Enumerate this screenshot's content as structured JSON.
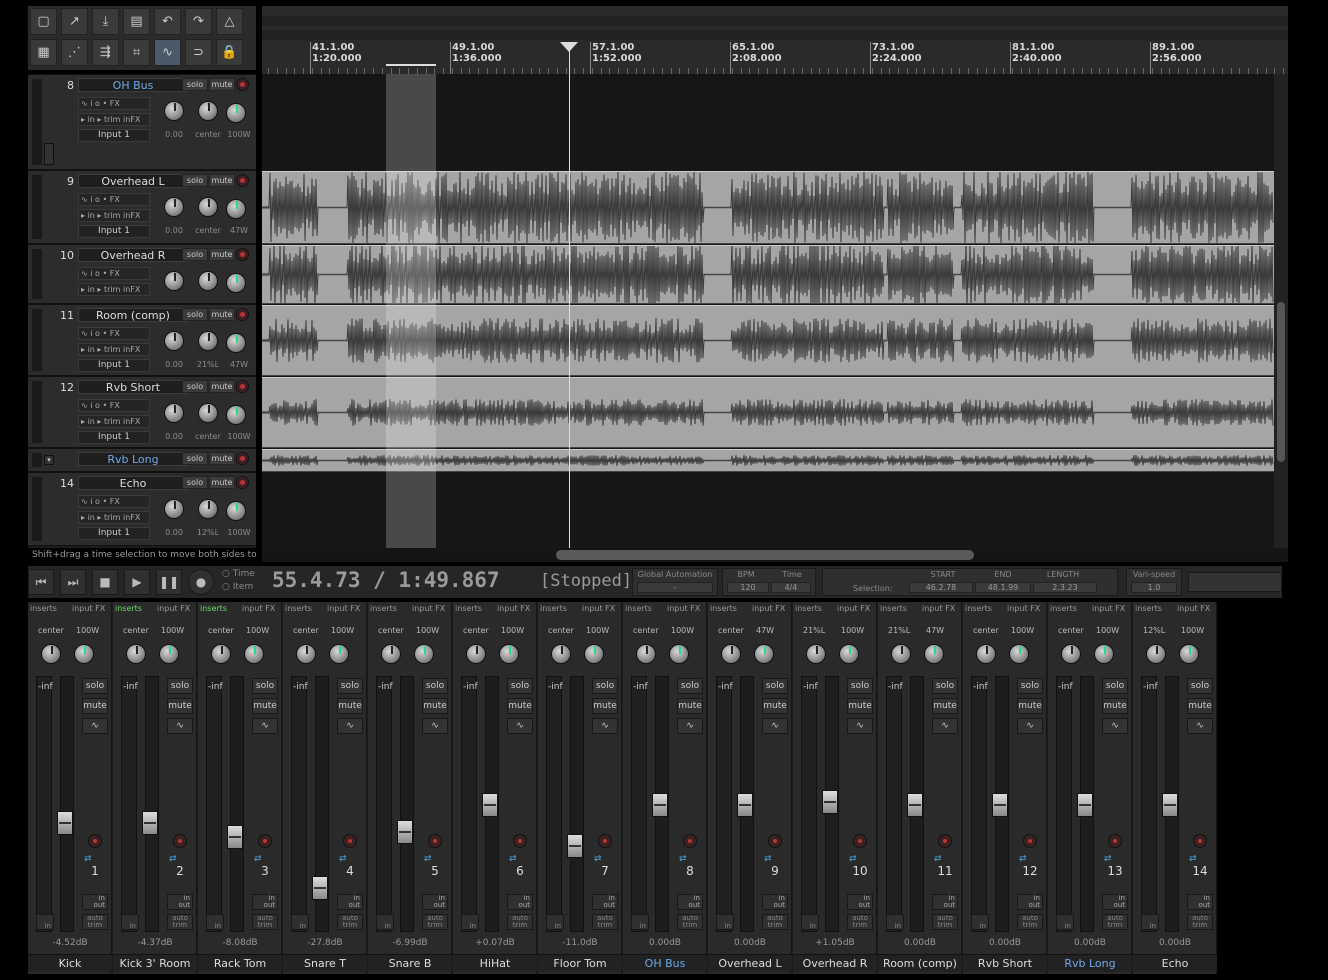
{
  "toolbar": {
    "icons": [
      "new-project-icon",
      "open-project-icon",
      "save-project-icon",
      "project-settings-icon",
      "undo-icon",
      "redo-icon",
      "metronome-icon",
      "grid-icon",
      "snap-icon",
      "ripple-edit-icon",
      "item-grouping-icon",
      "envelope-icon",
      "loop-icon",
      "lock-icon"
    ]
  },
  "tracks": [
    {
      "num": "8",
      "name": "OH Bus",
      "blue": true,
      "vol": "0.00",
      "pan": "center",
      "width": "100W",
      "input": "Input 1"
    },
    {
      "num": "9",
      "name": "Overhead L",
      "blue": false,
      "vol": "0.00",
      "pan": "center",
      "width": "47W",
      "input": "Input 1"
    },
    {
      "num": "10",
      "name": "Overhead R",
      "blue": false,
      "vol": "",
      "pan": "",
      "width": "",
      "input": ""
    },
    {
      "num": "11",
      "name": "Room (comp)",
      "blue": false,
      "vol": "0.00",
      "pan": "21%L",
      "width": "47W",
      "input": "Input 1"
    },
    {
      "num": "12",
      "name": "Rvb Short",
      "blue": false,
      "vol": "0.00",
      "pan": "center",
      "width": "100W",
      "input": "Input 1"
    },
    {
      "num": "",
      "name": "Rvb Long",
      "blue": true,
      "vol": "",
      "pan": "",
      "width": "",
      "input": ""
    },
    {
      "num": "14",
      "name": "Echo",
      "blue": false,
      "vol": "0.00",
      "pan": "12%L",
      "width": "100W",
      "input": "Input 1"
    }
  ],
  "tcp_labels": {
    "solo": "solo",
    "mute": "mute",
    "io": "i o",
    "fx": "FX",
    "in": "in",
    "trim": "trim",
    "infx": "inFX"
  },
  "ruler": [
    {
      "bar": "41.1.00",
      "time": "1:20.000"
    },
    {
      "bar": "49.1.00",
      "time": "1:36.000"
    },
    {
      "bar": "57.1.00",
      "time": "1:52.000"
    },
    {
      "bar": "65.1.00",
      "time": "2:08.000"
    },
    {
      "bar": "73.1.00",
      "time": "2:24.000"
    },
    {
      "bar": "81.1.00",
      "time": "2:40.000"
    },
    {
      "bar": "89.1.00",
      "time": "2:56.000"
    }
  ],
  "hint": "Shift+drag a time selection to move both sides togeth",
  "transport": {
    "time_label": "Time",
    "item_label": "Item",
    "position": "55.4.73 / 1:49.867",
    "status": "[Stopped]",
    "global_automation_label": "Global Automation",
    "global_automation_value": "-",
    "bpm_label": "BPM",
    "bpm": "120",
    "timesig_label": "Time",
    "timesig": "4/4",
    "selection_label": "Selection:",
    "start_label": "START",
    "start": "46.2.78",
    "end_label": "END",
    "end": "48.1.99",
    "length_label": "LENGTH",
    "length": "2.3.23",
    "varispeed_label": "Vari-speed",
    "varispeed": "1.0"
  },
  "mixer": {
    "labels": {
      "inserts": "inserts",
      "inputfx": "input FX",
      "inf": "-inf",
      "solo": "solo",
      "mute": "mute",
      "in": "in",
      "out": "out",
      "auto": "auto",
      "trim": "trim"
    },
    "channels": [
      {
        "num": "1",
        "name": "Kick",
        "pan": "center",
        "width": "100W",
        "vol": "-4.52dB",
        "fader": 0.42,
        "blue": false,
        "ins_on": false
      },
      {
        "num": "2",
        "name": "Kick 3' Room",
        "pan": "center",
        "width": "100W",
        "vol": "-4.37dB",
        "fader": 0.42,
        "blue": false,
        "ins_on": true
      },
      {
        "num": "3",
        "name": "Rack Tom",
        "pan": "center",
        "width": "100W",
        "vol": "-8.08dB",
        "fader": 0.36,
        "blue": false,
        "ins_on": true
      },
      {
        "num": "4",
        "name": "Snare T",
        "pan": "center",
        "width": "100W",
        "vol": "-27.8dB",
        "fader": 0.14,
        "blue": false,
        "ins_on": false
      },
      {
        "num": "5",
        "name": "Snare B",
        "pan": "center",
        "width": "100W",
        "vol": "-6.99dB",
        "fader": 0.38,
        "blue": false,
        "ins_on": false
      },
      {
        "num": "6",
        "name": "HiHat",
        "pan": "center",
        "width": "100W",
        "vol": "+0.07dB",
        "fader": 0.5,
        "blue": false,
        "ins_on": false
      },
      {
        "num": "7",
        "name": "Floor Tom",
        "pan": "center",
        "width": "100W",
        "vol": "-11.0dB",
        "fader": 0.32,
        "blue": false,
        "ins_on": false
      },
      {
        "num": "8",
        "name": "OH Bus",
        "pan": "center",
        "width": "100W",
        "vol": "0.00dB",
        "fader": 0.5,
        "blue": true,
        "ins_on": false
      },
      {
        "num": "9",
        "name": "Overhead L",
        "pan": "center",
        "width": "47W",
        "vol": "0.00dB",
        "fader": 0.5,
        "blue": false,
        "ins_on": false
      },
      {
        "num": "10",
        "name": "Overhead R",
        "pan": "21%L",
        "width": "100W",
        "vol": "+1.05dB",
        "fader": 0.51,
        "blue": false,
        "ins_on": false
      },
      {
        "num": "11",
        "name": "Room (comp)",
        "pan": "21%L",
        "width": "47W",
        "vol": "0.00dB",
        "fader": 0.5,
        "blue": false,
        "ins_on": false
      },
      {
        "num": "12",
        "name": "Rvb Short",
        "pan": "center",
        "width": "100W",
        "vol": "0.00dB",
        "fader": 0.5,
        "blue": false,
        "ins_on": false
      },
      {
        "num": "13",
        "name": "Rvb Long",
        "pan": "center",
        "width": "100W",
        "vol": "0.00dB",
        "fader": 0.5,
        "blue": true,
        "ins_on": false
      },
      {
        "num": "14",
        "name": "Echo",
        "pan": "12%L",
        "width": "100W",
        "vol": "0.00dB",
        "fader": 0.5,
        "blue": false,
        "ins_on": false
      }
    ]
  }
}
